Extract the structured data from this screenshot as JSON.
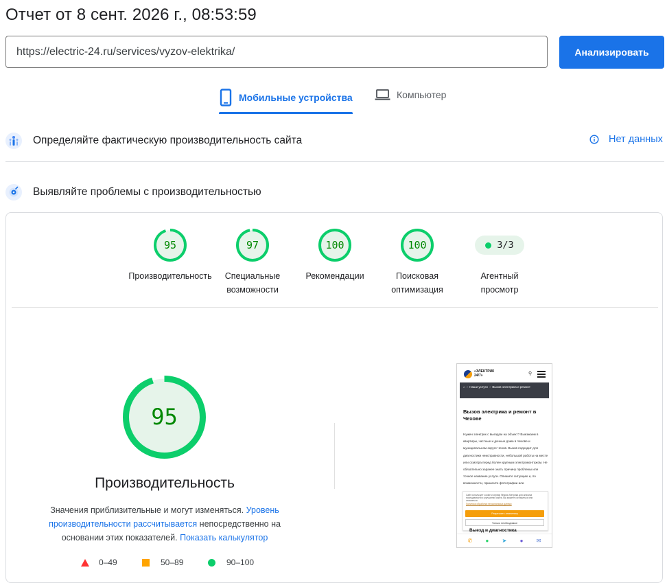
{
  "header": {
    "title": "Отчет от 8 сент. 2026 г., 08:53:59",
    "url_value": "https://electric-24.ru/services/vyzov-elektrika/",
    "analyze_label": "Анализировать"
  },
  "tabs": {
    "mobile_label": "Мобильные устройства",
    "desktop_label": "Компьютер",
    "active": "mobile"
  },
  "field_data": {
    "title": "Определяйте фактическую производительность сайта",
    "no_data_label": "Нет данных"
  },
  "lab": {
    "title": "Выявляйте проблемы с производительностью"
  },
  "categories": [
    {
      "score": "95",
      "label_line1": "Производительность",
      "label_line2": ""
    },
    {
      "score": "97",
      "label_line1": "Специальные",
      "label_line2": "возможности"
    },
    {
      "score": "100",
      "label_line1": "Рекомендации",
      "label_line2": ""
    },
    {
      "score": "100",
      "label_line1": "Поисковая",
      "label_line2": "оптимизация"
    }
  ],
  "agentic": {
    "value": "3/3",
    "label_line1": "Агентный",
    "label_line2": "просмотр"
  },
  "performance": {
    "score": "95",
    "label": "Производительность",
    "desc_part1": "Значения приблизительные и могут изменяться. ",
    "desc_link1": "Уровень производительности рассчитывается",
    "desc_part2": " непосредственно на основании этих показателей. ",
    "desc_link2": "Показать калькулятор"
  },
  "legend": {
    "fail": "0–49",
    "average": "50–89",
    "pass": "90–100"
  },
  "colors": {
    "accent": "#1a73e8",
    "pass": "#0cce6b",
    "pass_text": "#008800",
    "average": "#ffa400",
    "fail": "#ff3333"
  },
  "screenshot": {
    "logo_line1": "«ЭЛЕКТРИК",
    "logo_line2": "24/7»",
    "bread_item": "Наши услуги",
    "bread_current": "Вызов электрика и ремонт",
    "heading": "Вызов электрика и ремонт в Чехове",
    "body": "Нужен электрик с выездом на объект? Выезжаем в квартиры, частные и дачные дома в Чехове и муниципальном округе Чехов. Вызов подходит для диагностики неисправности, небольшой работы на месте или осмотра перед более крупным электромонтажом. Не обязательно заранее знать причину проблемы или точное название услуги. Опишите ситуацию и, по возможности, пришлите фотографии или",
    "cookie_text": "Сайт использует cookie и сервис Яндекс.Метрика для анализа посещаемости и улучшения сайта. Вы можете согласиться или отказаться.",
    "cookie_link": "Политика обработки персональных данных",
    "accept_label": "Разрешить аналитику",
    "necessary_label": "Только необходимые",
    "subheading": "Выезд и диагностика"
  }
}
